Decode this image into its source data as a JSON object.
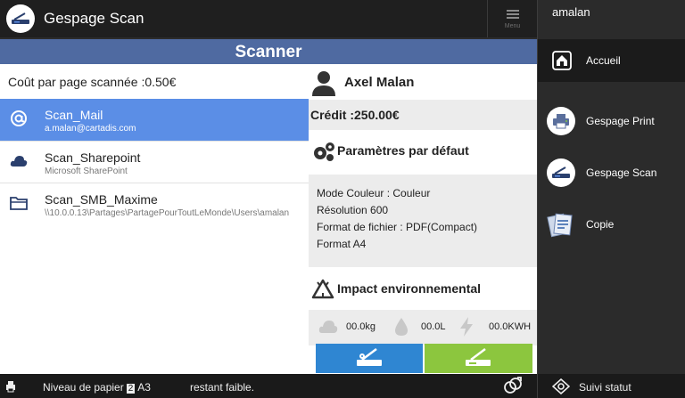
{
  "app": {
    "title": "Gespage Scan",
    "menu_label": "Menu"
  },
  "banner": {
    "title": "Scanner"
  },
  "cost": {
    "text": "Coût par page scannée :0.50€"
  },
  "destinations": [
    {
      "name": "Scan_Mail",
      "sub": "a.malan@cartadis.com",
      "icon": "at-icon",
      "selected": true
    },
    {
      "name": "Scan_Sharepoint",
      "sub": "Microsoft SharePoint",
      "icon": "cloud-icon",
      "selected": false
    },
    {
      "name": "Scan_SMB_Maxime",
      "sub": "\\\\10.0.0.13\\Partages\\PartagePourToutLeMonde\\Users\\amalan",
      "icon": "folder-icon",
      "selected": false
    }
  ],
  "user_info": {
    "name": "Axel Malan",
    "credit": "Crédit :250.00€"
  },
  "defaults": {
    "title": "Paramètres par défaut",
    "lines": [
      "Mode Couleur : Couleur",
      "Résolution 600",
      "Format de fichier : PDF(Compact)",
      "Format A4"
    ]
  },
  "impact": {
    "title": "Impact environnemental",
    "co2": "00.0kg",
    "water": "00.0L",
    "energy": "00.0KWH"
  },
  "sidebar": {
    "user": "amalan",
    "items": [
      {
        "label": "Accueil",
        "icon": "home-icon"
      },
      {
        "label": "Gespage Print",
        "icon": "printer-icon"
      },
      {
        "label": "Gespage Scan",
        "icon": "scanner-icon"
      },
      {
        "label": "Copie",
        "icon": "copy-icon"
      }
    ]
  },
  "status_bar": {
    "paper_prefix": "Niveau de papier",
    "tray": "2",
    "size": "A3",
    "paper_suffix": "restant faible.",
    "status_link": "Suivi statut"
  },
  "colors": {
    "banner": "#4f6aa1",
    "selected": "#5b8ee6",
    "scan_button": "#2f86d2",
    "scan_alt_button": "#8cc63e"
  }
}
